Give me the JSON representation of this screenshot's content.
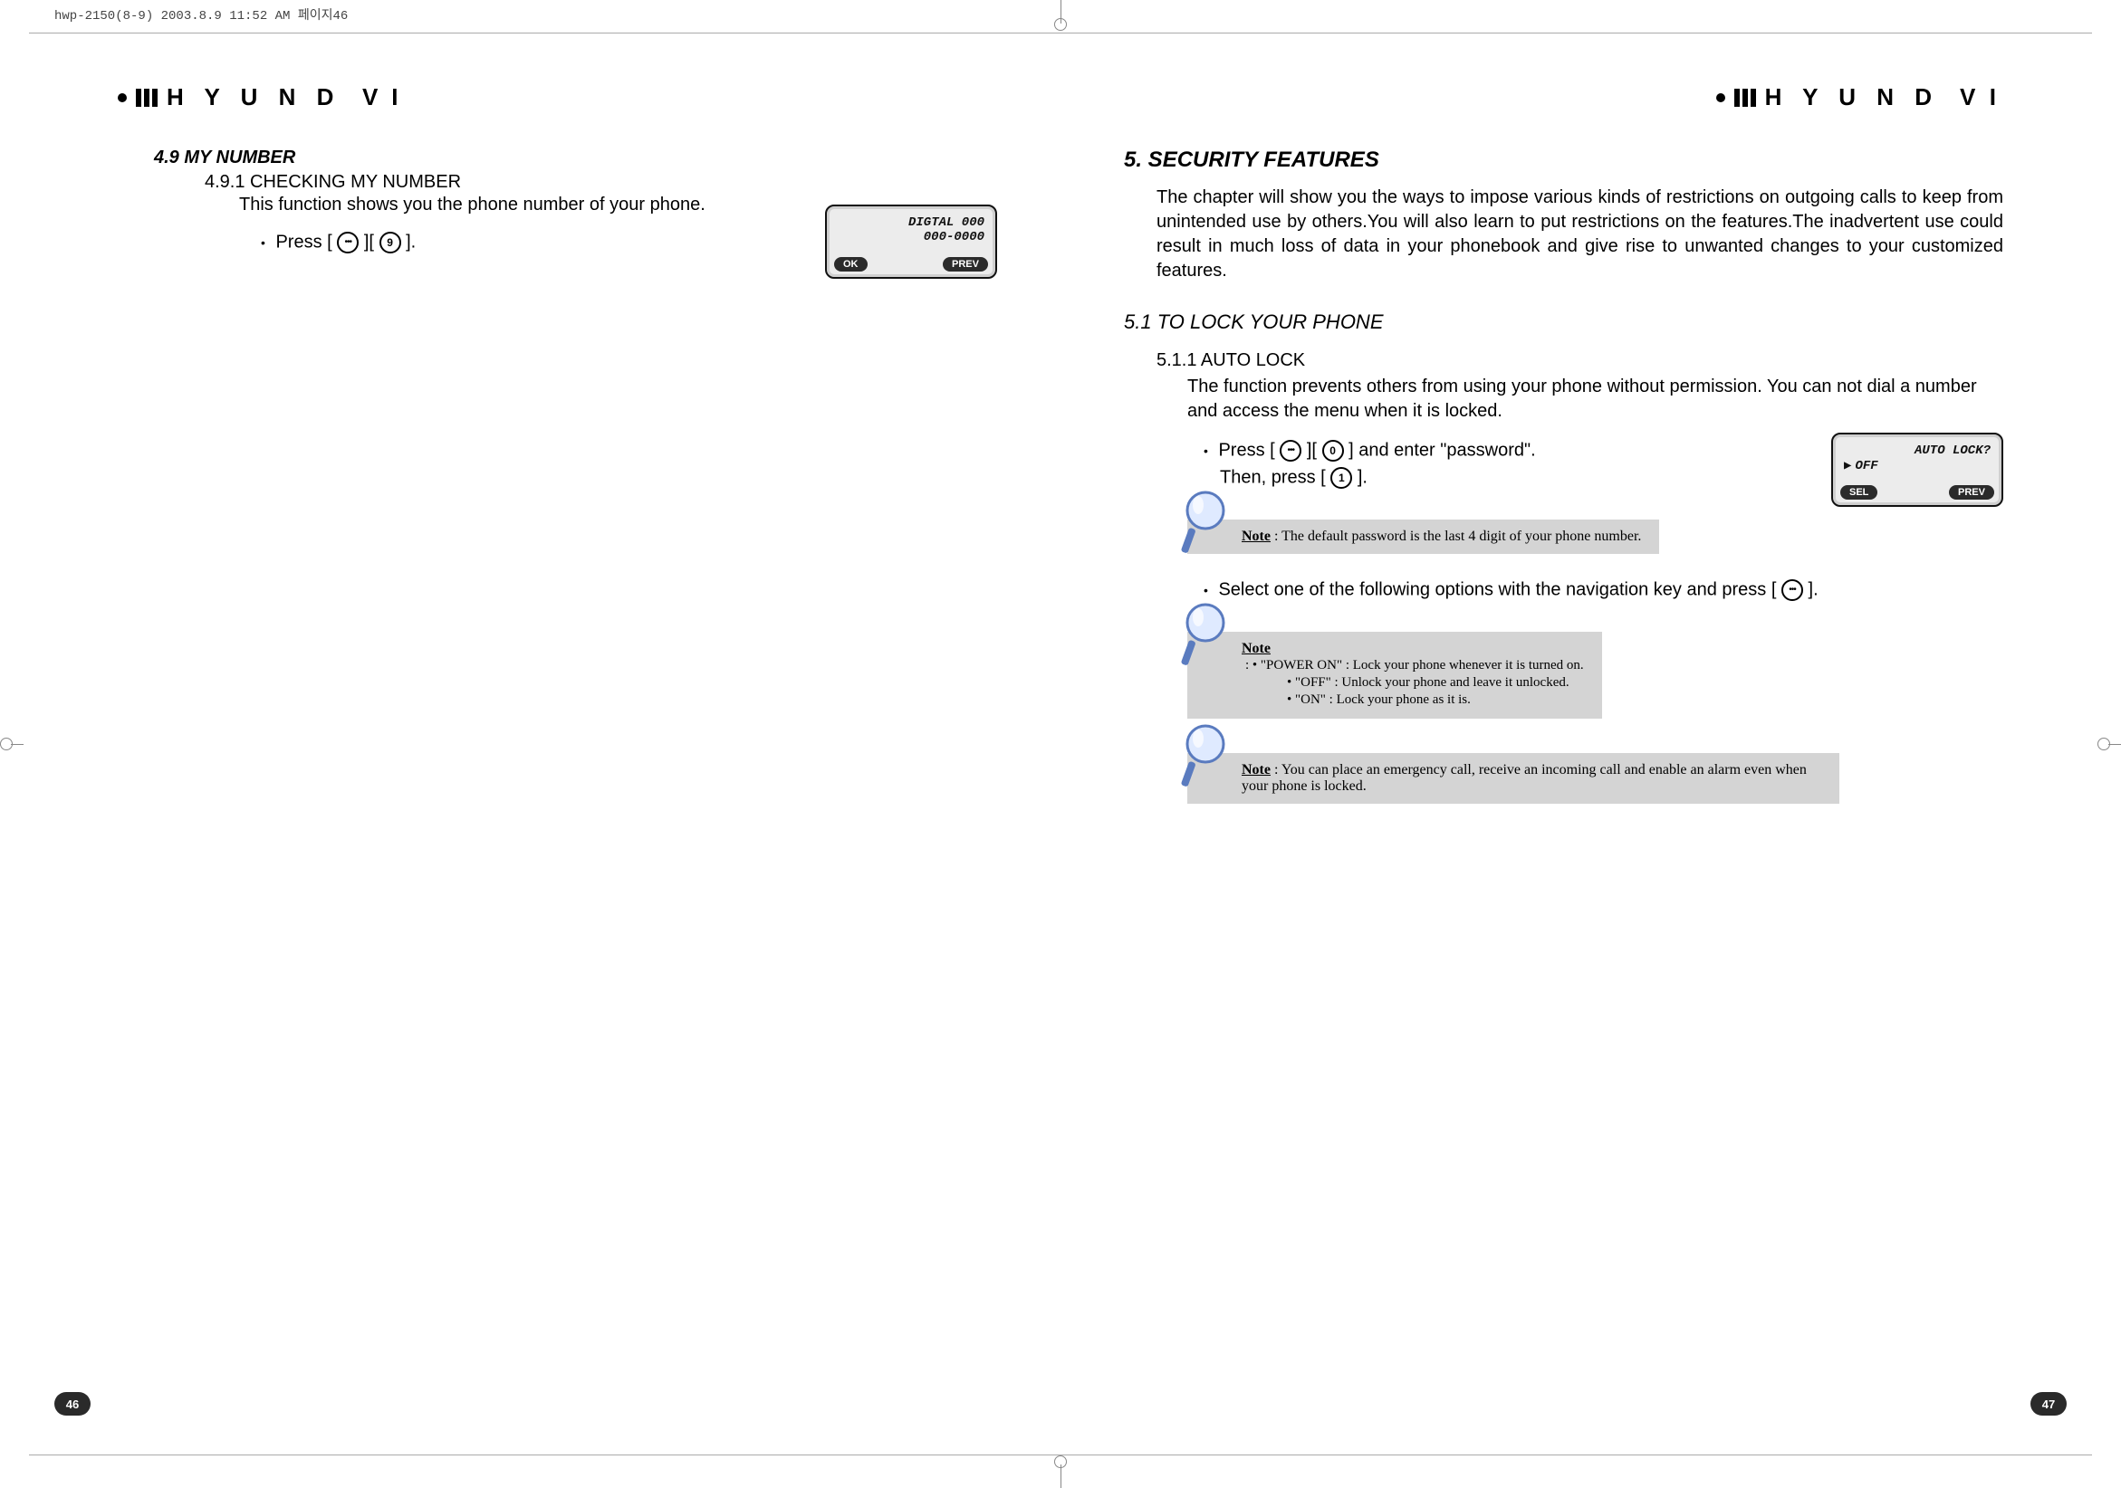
{
  "print_header": "hwp-2150(8-9)  2003.8.9 11:52 AM  페이지46",
  "left": {
    "brand": "HYUNDAI",
    "sec_49": "4.9 MY NUMBER",
    "sec_491": "4.9.1 CHECKING MY NUMBER",
    "desc_491": "This function shows you the phone number of your phone.",
    "step_press_prefix": "Press [",
    "bracket_mid": "][",
    "bracket_end": "].",
    "key9_glyph": "9",
    "phone": {
      "line1": "DIGTAL 000",
      "line2": "000-0000",
      "sk_left": "OK",
      "sk_right": "PREV"
    },
    "page_num": "46"
  },
  "right": {
    "brand": "HYUNDAI",
    "chapter": "5. SECURITY FEATURES",
    "chapter_intro": "The chapter will show you the ways to impose various kinds of restrictions on outgoing calls to keep from unintended use by others.You will also learn to put restrictions on the features.The inadvertent use could result in much loss of data in your phonebook and give rise to unwanted changes to your customized features.",
    "sec_51": "5.1 TO LOCK YOUR PHONE",
    "sec_511": "5.1.1 AUTO LOCK",
    "desc_511": "The function prevents others from using your phone without permission. You can not dial a number and access the menu when it is locked.",
    "step1_prefix": "Press [",
    "step1_mid": "][",
    "step1_suffix": "] and enter \"password\".",
    "step1b_prefix": "Then, press [",
    "step1b_suffix": "].",
    "key0_glyph": "0",
    "key1_glyph": "1",
    "note1_label": "Note",
    "note1_text": ": The default password is the last 4 digit of your phone number.",
    "step2_prefix": "Select one of the following options with the navigation key and press [",
    "step2_suffix": "].",
    "note2_label": "Note",
    "note2_lines": [
      ": • \"POWER ON\" : Lock your phone whenever it is turned on.",
      "• \"OFF\" : Unlock your phone and leave it unlocked.",
      "• \"ON\" : Lock your phone as it is."
    ],
    "note3_label": "Note",
    "note3_text": ": You can place an emergency call, receive an incoming call and enable an alarm even when your phone is locked.",
    "phone": {
      "line1": "AUTO LOCK?",
      "line2": "OFF",
      "sk_left": "SEL",
      "sk_right": "PREV"
    },
    "page_num": "47"
  }
}
